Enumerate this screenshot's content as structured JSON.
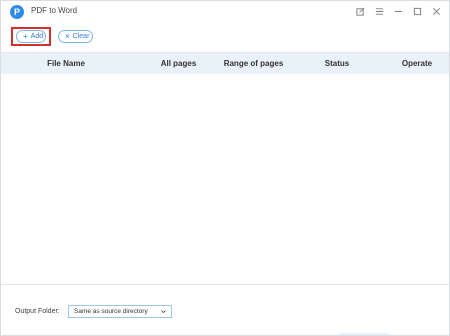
{
  "window": {
    "title": "PDF to Word",
    "logo_letter": "P",
    "accent": "#2f8be6"
  },
  "toolbar": {
    "add_icon": "+",
    "add_label": "Add",
    "clear_icon": "×",
    "clear_label": "Clear",
    "highlight_color": "#d32f2f"
  },
  "table": {
    "columns": [
      "File Name",
      "All pages",
      "Range of pages",
      "Status",
      "Operate"
    ],
    "header_bg": "#e9f1fb",
    "rows": []
  },
  "footer": {
    "output_label": "Output Folder:",
    "output_value": "Same as source directory"
  },
  "icons": [
    "pdf-logo-icon",
    "edit-icon",
    "menu-icon",
    "minimize-icon",
    "maximize-icon",
    "close-icon",
    "plus-icon",
    "clear-x-icon",
    "dropdown-caret-icon"
  ]
}
